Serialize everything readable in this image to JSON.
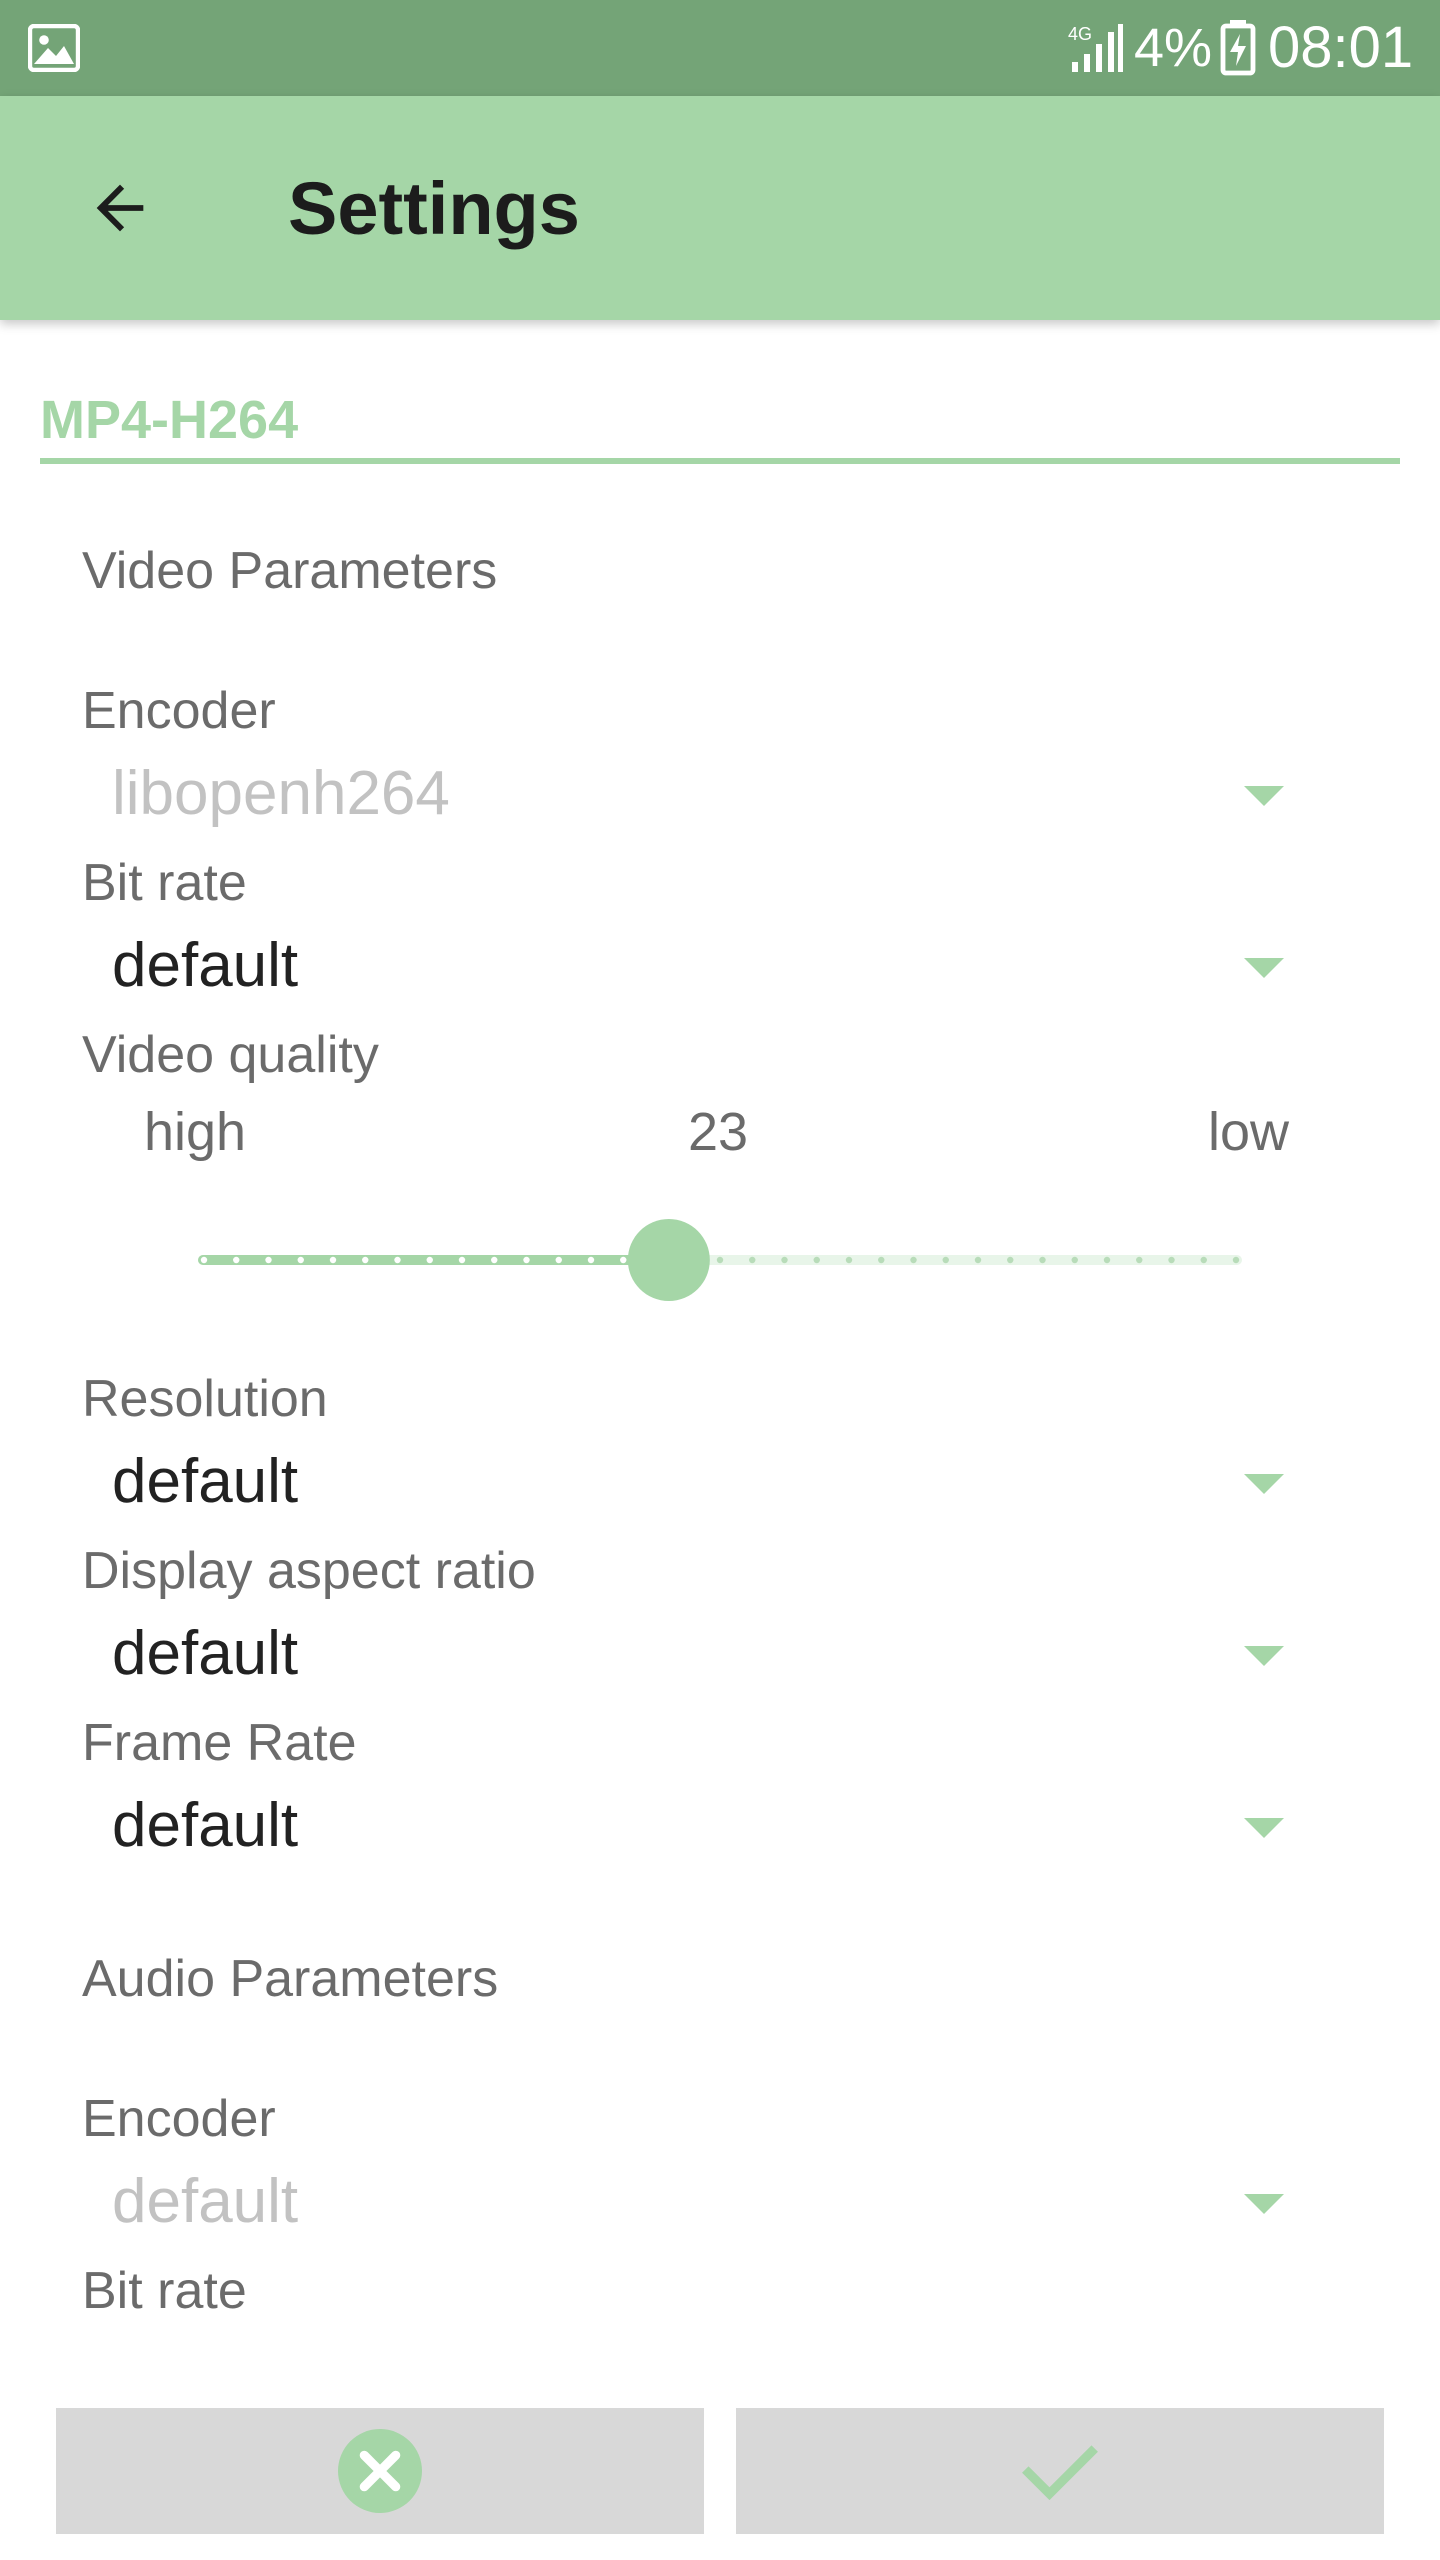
{
  "status_bar": {
    "network": "4G",
    "battery": "4%",
    "time": "08:01"
  },
  "app_bar": {
    "title": "Settings"
  },
  "preset": {
    "name": "MP4-H264"
  },
  "video": {
    "section_title": "Video Parameters",
    "encoder": {
      "label": "Encoder",
      "value": "libopenh264",
      "enabled": false
    },
    "bit_rate": {
      "label": "Bit rate",
      "value": "default"
    },
    "quality": {
      "label": "Video quality",
      "min_label": "high",
      "value": "23",
      "max_label": "low",
      "slider_min": 0,
      "slider_max": 51,
      "slider_value": 23,
      "ticks": 33
    },
    "resolution": {
      "label": "Resolution",
      "value": "default"
    },
    "aspect_ratio": {
      "label": "Display aspect ratio",
      "value": "default"
    },
    "frame_rate": {
      "label": "Frame Rate",
      "value": "default"
    }
  },
  "audio": {
    "section_title": "Audio Parameters",
    "encoder": {
      "label": "Encoder",
      "value": "default",
      "enabled": false
    },
    "bit_rate": {
      "label": "Bit rate"
    }
  },
  "actions": {
    "cancel_icon": "cancel-circle-icon",
    "confirm_icon": "check-icon"
  },
  "colors": {
    "accent": "#a5d6a7",
    "status_bar": "#74a477",
    "button_bg": "#d8d8d8"
  }
}
